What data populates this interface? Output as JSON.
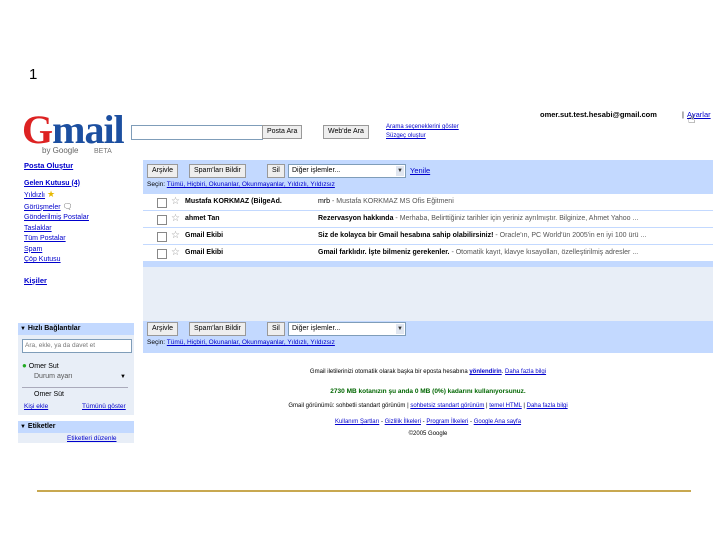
{
  "slide": {
    "number": "1"
  },
  "logo": {
    "main": "Gmail",
    "by": "by Google",
    "beta": "BETA"
  },
  "header": {
    "account_email": "omer.sut.test.hesabi@gmail.com",
    "separator": "|",
    "settings_link": "Ayarlar",
    "search_mail_button": "Posta Ara",
    "search_web_button": "Web'de Ara",
    "show_search_options": "Arama seçeneklerini göster",
    "create_filter": "Süzgeç oluştur"
  },
  "sidebar": {
    "compose": "Posta Oluştur",
    "items": [
      "Gelen Kutusu (4)",
      "Yıldızlı",
      "Görüşmeler",
      "Gönderilmiş Postalar",
      "Taslaklar",
      "Tüm Postalar",
      "Spam",
      "Çöp Kutusu"
    ],
    "contacts": "Kişiler",
    "quick_contacts": {
      "title": "Hızlı Bağlantılar",
      "search_placeholder": "Ara, ekle, ya da davet et",
      "user_name": "Omer Sut",
      "status": "Durum ayarı",
      "contact": "Omer Süt",
      "add_link": "Kişi ekle",
      "show_all": "Tümünü göster"
    },
    "labels": {
      "title": "Etiketler",
      "edit": "Etiketleri düzenle"
    }
  },
  "toolbar": {
    "archive": "Arşivle",
    "report_spam": "Spam'ları Bildir",
    "delete": "Sil",
    "more_actions": "Diğer işlemler...",
    "refresh": "Yenile",
    "select_label": "Seçin:",
    "select_options": "Tümü, Hiçbiri, Okunanlar, Okunmayanlar, Yıldızlı, Yıldızsız"
  },
  "emails": [
    {
      "from": "Mustafa KORKMAZ (BilgeAd.",
      "subject": "mrb",
      "snippet": " - Mustafa KORKMAZ MS Ofis Eğitmeni",
      "subject_bold": false
    },
    {
      "from": "ahmet Tan",
      "subject": "Rezervasyon hakkında",
      "snippet": " - Merhaba, Belirttiğiniz tarihler için yeriniz ayrılmıştır. Bilginize, Ahmet Yahoo ...",
      "subject_bold": true
    },
    {
      "from": "Gmail Ekibi",
      "subject": "Siz de kolayca bir Gmail hesabına sahip olabilirsiniz!",
      "snippet": " - Oracle'ın, PC World'ün 2005'in en iyi 100 ürü ...",
      "subject_bold": true
    },
    {
      "from": "Gmail Ekibi",
      "subject": "Gmail farklıdır. İşte bilmeniz gerekenler.",
      "snippet": " - Otomatik kayıt, klavye kısayolları, özelleştirilmiş adresler ...",
      "subject_bold": true
    }
  ],
  "footer": {
    "forward_text": "Gmail iletilerinizi otomatik olarak başka bir eposta hesabına ",
    "forward_link": "yönlendirin",
    "forward_sep": ". ",
    "learn_more": "Daha fazla bilgi",
    "quota": "2730 MB kotanızın şu anda 0 MB (0%) kadarını kullanıyorsunuz.",
    "view_text": "Gmail görünümü: sohbetli standart görünüm | ",
    "view_link1": "sohbetsiz standart görünüm",
    "view_sep": " | ",
    "view_link2": "temel HTML",
    "view_link3": "Daha fazla bilgi",
    "links": [
      "Kullanım Şartları",
      "Gizlilik İlkeleri",
      "Program İlkeleri",
      "Google Ana sayfa"
    ],
    "copyright": "©2005 Google"
  },
  "colors": {
    "accent_bar": "#c3d9ff",
    "box_bg": "#e8eef7",
    "bottom_rule": "#c8a850",
    "link": "#0000cc"
  }
}
